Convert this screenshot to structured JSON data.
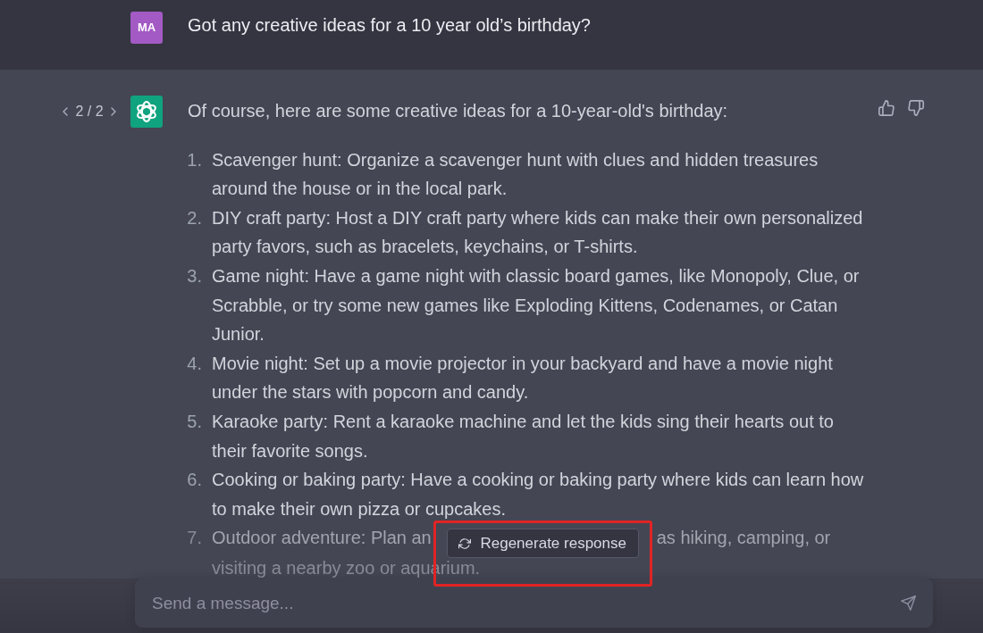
{
  "user_message": {
    "avatar_initials": "MA",
    "text": "Got any creative ideas for a 10 year old’s birthday?"
  },
  "assistant_message": {
    "counter": "2 / 2",
    "intro": "Of course, here are some creative ideas for a 10-year-old's birthday:",
    "items": [
      {
        "kind": "full",
        "number": "1.",
        "text": "Scavenger hunt: Organize a scavenger hunt with clues and hidden treasures around the house or in the local park."
      },
      {
        "kind": "full",
        "number": "2.",
        "text": "DIY craft party: Host a DIY craft party where kids can make their own personalized party favors, such as bracelets, keychains, or T-shirts."
      },
      {
        "kind": "full",
        "number": "3.",
        "text": "Game night: Have a game night with classic board games, like Monopoly, Clue, or Scrabble, or try some new games like Exploding Kittens, Codenames, or Catan Junior."
      },
      {
        "kind": "full",
        "number": "4.",
        "text": "Movie night: Set up a movie projector in your backyard and have a movie night under the stars with popcorn and candy."
      },
      {
        "kind": "full",
        "number": "5.",
        "text": "Karaoke party: Rent a karaoke machine and let the kids sing their hearts out to their favorite songs."
      },
      {
        "kind": "full",
        "number": "6.",
        "text": "Cooking or baking party: Have a cooking or baking party where kids can learn how to make their own pizza or cupcakes."
      },
      {
        "kind": "covered",
        "number": "7.",
        "text_before": "Outdoor adventure: Plan an",
        "text_after": "as hiking, camping, or",
        "text_next_line": "visiting a nearby zoo or aquarium."
      }
    ]
  },
  "regenerate_button": {
    "label": "Regenerate response"
  },
  "composer": {
    "placeholder": "Send a message..."
  }
}
